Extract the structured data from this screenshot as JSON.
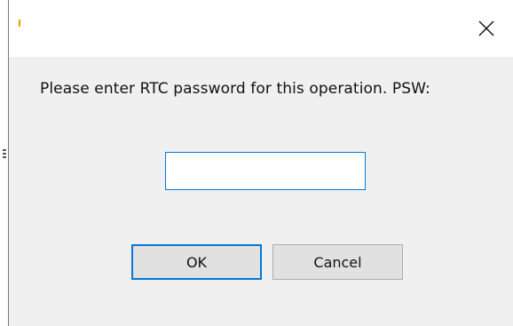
{
  "dialog": {
    "prompt": "Please enter RTC password for this operation. PSW:",
    "password_value": "",
    "ok_label": "OK",
    "cancel_label": "Cancel",
    "close_icon": "close-icon",
    "colors": {
      "focus_accent": "#0078d7",
      "button_face": "#e1e1e1",
      "dialog_bg": "#f0f0f0"
    }
  }
}
